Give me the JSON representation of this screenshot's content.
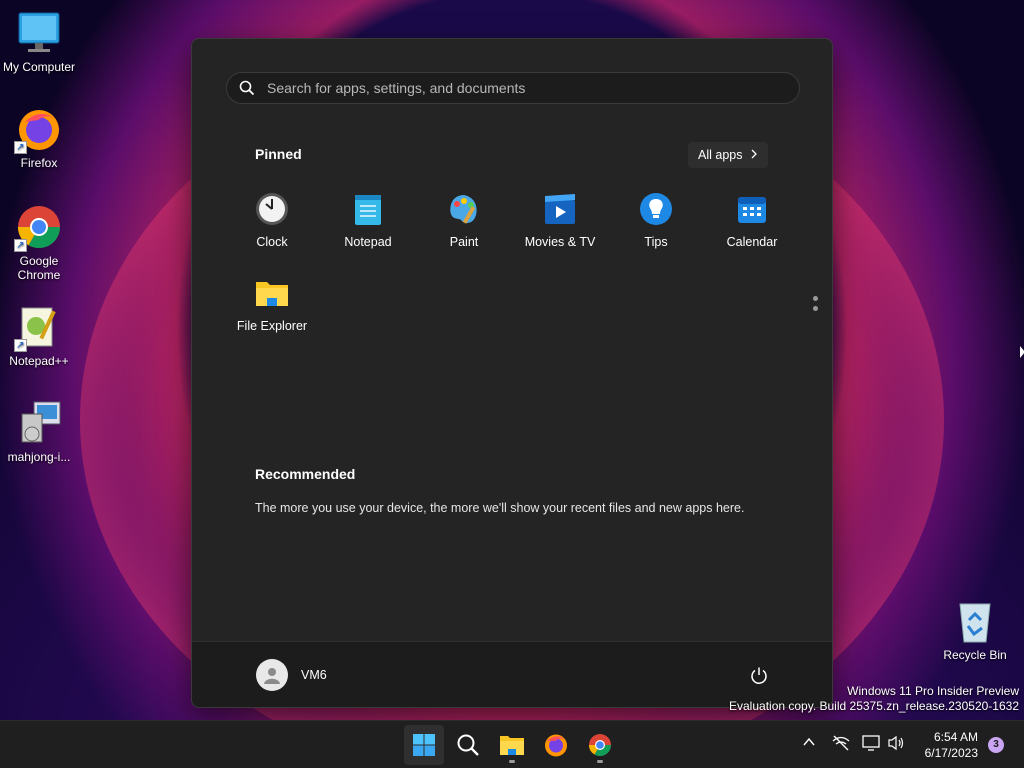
{
  "desktop": {
    "icons": [
      {
        "label": "My Computer",
        "icon": "monitor-icon"
      },
      {
        "label": "Firefox",
        "icon": "firefox-icon"
      },
      {
        "label": "Google Chrome",
        "icon": "chrome-icon"
      },
      {
        "label": "Notepad++",
        "icon": "notepadpp-icon"
      },
      {
        "label": "mahjong-i...",
        "icon": "installer-icon"
      }
    ],
    "recycle_bin": "Recycle Bin",
    "watermark": {
      "line1": "Windows 11 Pro Insider Preview",
      "line2": "Evaluation copy. Build 25375.zn_release.230520-1632"
    }
  },
  "start_menu": {
    "search_placeholder": "Search for apps, settings, and documents",
    "pinned_title": "Pinned",
    "all_apps_label": "All apps",
    "pinned_apps": [
      {
        "label": "Clock",
        "icon": "clock-icon"
      },
      {
        "label": "Notepad",
        "icon": "notepad-icon"
      },
      {
        "label": "Paint",
        "icon": "paint-icon"
      },
      {
        "label": "Movies & TV",
        "icon": "movies-icon"
      },
      {
        "label": "Tips",
        "icon": "tips-icon"
      },
      {
        "label": "Calendar",
        "icon": "calendar-icon"
      },
      {
        "label": "File Explorer",
        "icon": "folder-icon"
      }
    ],
    "recommended_title": "Recommended",
    "recommended_text": "The more you use your device, the more we'll show your recent files and new apps here.",
    "user_name": "VM6"
  },
  "taskbar": {
    "apps": [
      "start",
      "search",
      "file-explorer",
      "firefox",
      "chrome"
    ],
    "time": "6:54 AM",
    "date": "6/17/2023",
    "notification_count": "3"
  },
  "colors": {
    "menu_bg": "#242424",
    "footer_bg": "#1c1c1c",
    "accent": "#0078d4"
  }
}
